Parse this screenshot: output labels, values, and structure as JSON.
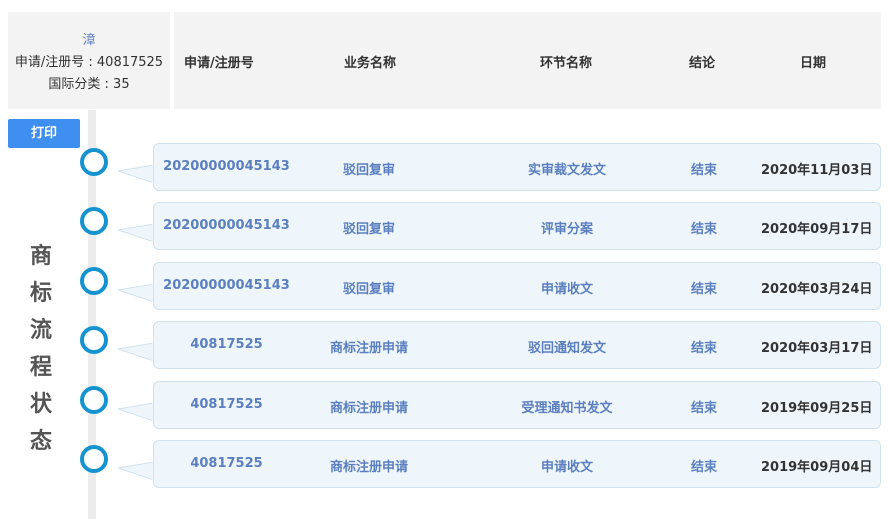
{
  "trademark": {
    "name": "漳",
    "regno_line": "申请/注册号 : 40817525",
    "class_line": "国际分类 : 35"
  },
  "header": {
    "regno": "申请/注册号",
    "business": "业务名称",
    "step": "环节名称",
    "result": "结论",
    "date": "日期"
  },
  "print_label": "打印",
  "side_title": [
    "商",
    "标",
    "流",
    "程",
    "状",
    "态"
  ],
  "rows": [
    {
      "regno": "20200000045143",
      "business": "驳回复审",
      "step": "实审裁文发文",
      "result": "结束",
      "date": "2020年11月03日"
    },
    {
      "regno": "20200000045143",
      "business": "驳回复审",
      "step": "评审分案",
      "result": "结束",
      "date": "2020年09月17日"
    },
    {
      "regno": "20200000045143",
      "business": "驳回复审",
      "step": "申请收文",
      "result": "结束",
      "date": "2020年03月24日"
    },
    {
      "regno": "40817525",
      "business": "商标注册申请",
      "step": "驳回通知发文",
      "result": "结束",
      "date": "2020年03月17日"
    },
    {
      "regno": "40817525",
      "business": "商标注册申请",
      "step": "受理通知书发文",
      "result": "结束",
      "date": "2019年09月25日"
    },
    {
      "regno": "40817525",
      "business": "商标注册申请",
      "step": "申请收文",
      "result": "结束",
      "date": "2019年09月04日"
    }
  ],
  "colors": {
    "accent": "#3f8ff0",
    "circle": "#1593d0",
    "card_bg": "#eef6fb",
    "link_text": "#5b7fbf"
  }
}
